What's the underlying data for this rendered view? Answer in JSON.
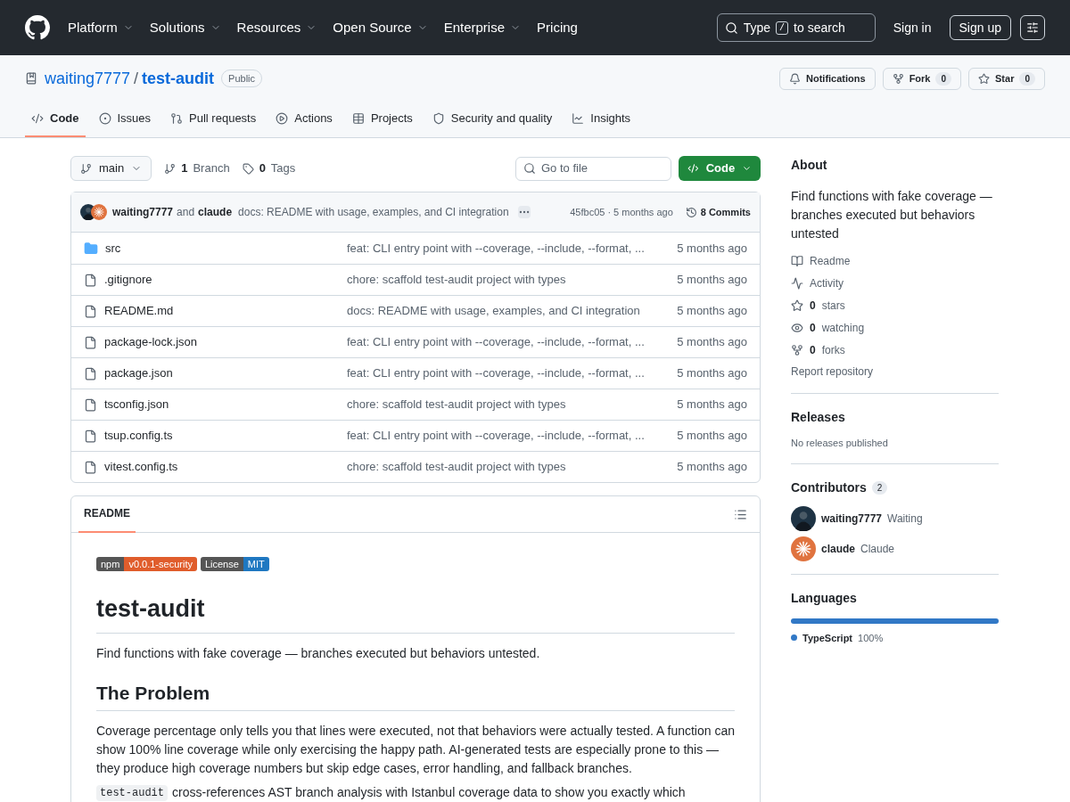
{
  "header": {
    "nav": [
      {
        "label": "Platform",
        "dropdown": true
      },
      {
        "label": "Solutions",
        "dropdown": true
      },
      {
        "label": "Resources",
        "dropdown": true
      },
      {
        "label": "Open Source",
        "dropdown": true
      },
      {
        "label": "Enterprise",
        "dropdown": true
      },
      {
        "label": "Pricing",
        "dropdown": false
      }
    ],
    "search": {
      "before": "Type",
      "key": "/",
      "after": "to search"
    },
    "sign_in": "Sign in",
    "sign_up": "Sign up"
  },
  "repo": {
    "owner": "waiting7777",
    "separator": "/",
    "name": "test-audit",
    "visibility": "Public",
    "notifications": "Notifications",
    "fork": "Fork",
    "fork_count": "0",
    "star": "Star",
    "star_count": "0"
  },
  "tabs": [
    {
      "label": "Code",
      "selected": true
    },
    {
      "label": "Issues",
      "selected": false
    },
    {
      "label": "Pull requests",
      "selected": false
    },
    {
      "label": "Actions",
      "selected": false
    },
    {
      "label": "Projects",
      "selected": false
    },
    {
      "label": "Security and quality",
      "selected": false
    },
    {
      "label": "Insights",
      "selected": false
    }
  ],
  "toolbar": {
    "branch": "main",
    "branches_count": "1",
    "branches_label": "Branch",
    "tags_count": "0",
    "tags_label": "Tags",
    "go_to_file": "Go to file",
    "code_button": "Code"
  },
  "commit": {
    "author": "waiting7777",
    "joiner": "and",
    "coauthor": "claude",
    "message": "docs: README with usage, examples, and CI integration",
    "sha": "45fbc05",
    "age": "· 5 months ago",
    "commits": "8 Commits"
  },
  "files": [
    {
      "name": "src",
      "kind": "folder",
      "message": "feat: CLI entry point with --coverage, --include, --format, ...",
      "age": "5 months ago"
    },
    {
      "name": ".gitignore",
      "kind": "file",
      "message": "chore: scaffold test-audit project with types",
      "age": "5 months ago"
    },
    {
      "name": "README.md",
      "kind": "file",
      "message": "docs: README with usage, examples, and CI integration",
      "age": "5 months ago"
    },
    {
      "name": "package-lock.json",
      "kind": "file",
      "message": "feat: CLI entry point with --coverage, --include, --format, ...",
      "age": "5 months ago"
    },
    {
      "name": "package.json",
      "kind": "file",
      "message": "feat: CLI entry point with --coverage, --include, --format, ...",
      "age": "5 months ago"
    },
    {
      "name": "tsconfig.json",
      "kind": "file",
      "message": "chore: scaffold test-audit project with types",
      "age": "5 months ago"
    },
    {
      "name": "tsup.config.ts",
      "kind": "file",
      "message": "feat: CLI entry point with --coverage, --include, --format, ...",
      "age": "5 months ago"
    },
    {
      "name": "vitest.config.ts",
      "kind": "file",
      "message": "chore: scaffold test-audit project with types",
      "age": "5 months ago"
    }
  ],
  "readme": {
    "tab": "README",
    "badges": [
      {
        "label": "npm",
        "value": "v0.0.1-security",
        "color": "#e05d2c"
      },
      {
        "label": "License",
        "value": "MIT",
        "color": "#1f78c1"
      }
    ],
    "title": "test-audit",
    "intro": "Find functions with fake coverage — branches executed but behaviors untested.",
    "section": "The Problem",
    "paragraph": "Coverage percentage only tells you that lines were executed, not that behaviors were actually tested. A function can show 100% line coverage while only exercising the happy path. AI-generated tests are especially prone to this — they produce high coverage numbers but skip edge cases, error handling, and fallback branches.",
    "code": "test-audit",
    "next": "cross-references AST branch analysis with Istanbul coverage data to show you exactly which"
  },
  "about": {
    "title": "About",
    "description": "Find functions with fake coverage — branches executed but behaviors untested",
    "links": [
      {
        "label": "Readme"
      },
      {
        "label": "Activity"
      },
      {
        "count": "0",
        "label": "stars"
      },
      {
        "count": "0",
        "label": "watching"
      },
      {
        "count": "0",
        "label": "forks"
      }
    ],
    "report": "Report repository"
  },
  "releases": {
    "title": "Releases",
    "note": "No releases published"
  },
  "contributors": {
    "title": "Contributors",
    "count": "2",
    "people": [
      {
        "login": "waiting7777",
        "name": "Waiting"
      },
      {
        "login": "claude",
        "name": "Claude"
      }
    ]
  },
  "languages": {
    "title": "Languages",
    "items": [
      {
        "name": "TypeScript",
        "percent": "100%",
        "level": 1,
        "color": "#3178c6"
      }
    ]
  }
}
